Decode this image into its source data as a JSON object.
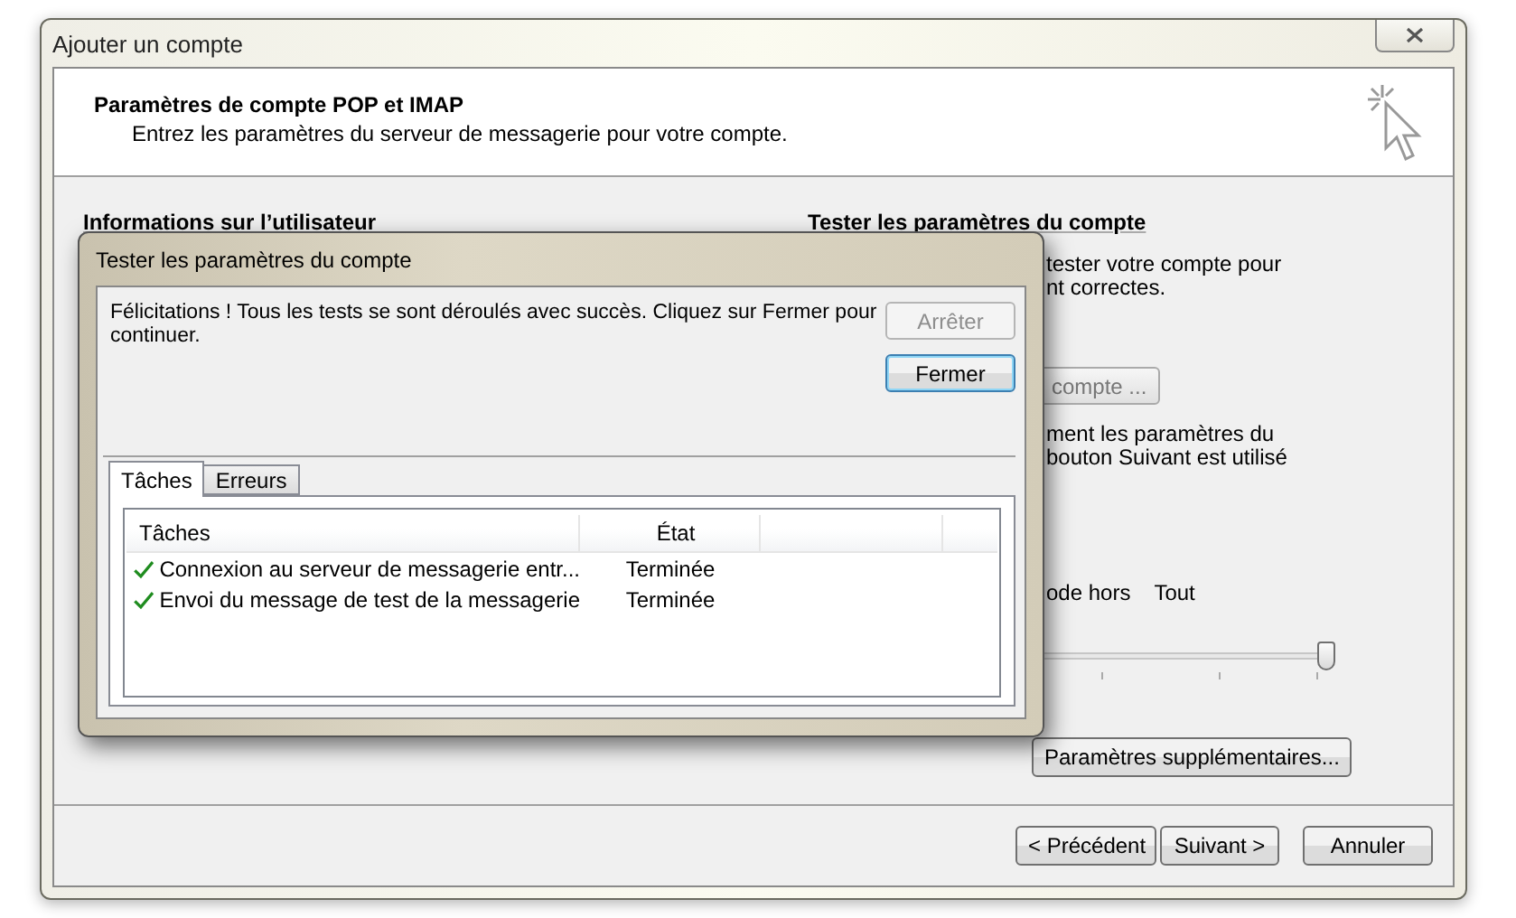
{
  "window": {
    "title": "Ajouter un compte"
  },
  "header": {
    "title": "Paramètres de compte POP et IMAP",
    "subtitle": "Entrez les paramètres du serveur de messagerie pour votre compte."
  },
  "user_info": {
    "heading": "Informations sur l’utilisateur"
  },
  "test_section": {
    "heading": "Tester les paramètres du compte",
    "lines": [
      "tester votre compte pour",
      "nt correctes."
    ],
    "test_button": "compte ...",
    "note_lines": [
      "ment les paramètres du",
      "bouton Suivant est utilisé"
    ],
    "offline_label": "ode hors",
    "offline_value": "Tout",
    "slider": {
      "level": 1
    }
  },
  "more_settings_button": "Paramètres supplémentaires...",
  "footer_buttons": [
    {
      "label": "< Précédent"
    },
    {
      "label": "Suivant >"
    },
    {
      "label": "Annuler"
    }
  ],
  "dialog": {
    "title": "Tester les paramètres du compte",
    "message": "Félicitations ! Tous les tests se sont déroulés avec succès. Cliquez sur Fermer pour continuer.",
    "buttons": [
      {
        "label": "Arrêter",
        "disabled": true,
        "default": false
      },
      {
        "label": "Fermer",
        "disabled": false,
        "default": true
      }
    ],
    "tabs": [
      {
        "label": "Tâches",
        "selected": true
      },
      {
        "label": "Erreurs",
        "selected": false
      }
    ],
    "columns": [
      "Tâches",
      "État"
    ],
    "rows": [
      {
        "task": "Connexion au serveur de messagerie entr...",
        "status": "Terminée",
        "done": true
      },
      {
        "task": "Envoi du message de test de la messagerie",
        "status": "Terminée",
        "done": true
      }
    ]
  }
}
